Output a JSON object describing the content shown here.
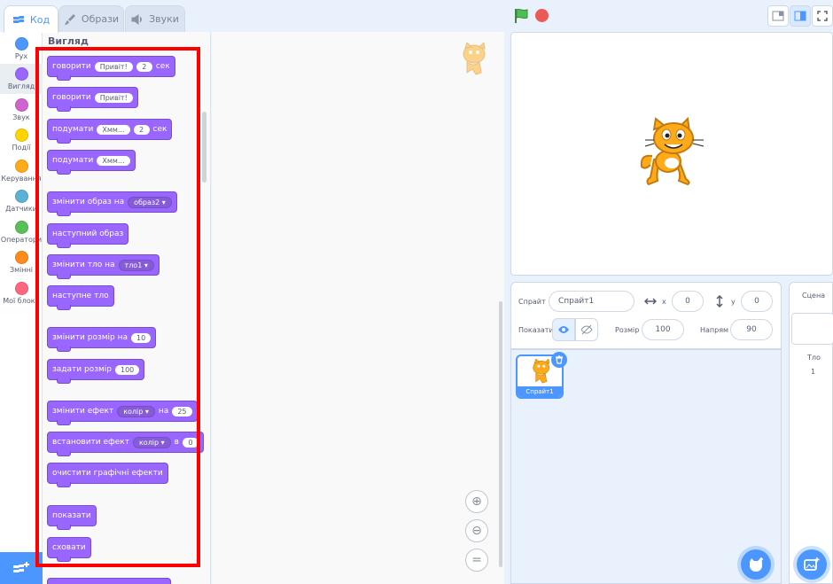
{
  "tabs": {
    "code": "Код",
    "costumes": "Образи",
    "sounds": "Звуки"
  },
  "categories": [
    {
      "label": "Рух",
      "color": "#4c97ff"
    },
    {
      "label": "Вигляд",
      "color": "#9966ff"
    },
    {
      "label": "Звук",
      "color": "#cf63cf"
    },
    {
      "label": "Події",
      "color": "#ffbf00"
    },
    {
      "label": "Керування",
      "color": "#ffab19"
    },
    {
      "label": "Датчики",
      "color": "#5cb1d6"
    },
    {
      "label": "Оператори",
      "color": "#59c059"
    },
    {
      "label": "Змінні",
      "color": "#ff8c1a"
    },
    {
      "label": "Мої блоки",
      "color": "#ff6680"
    }
  ],
  "palette": {
    "title": "Вигляд",
    "blocks": {
      "say_for": {
        "text": "говорити",
        "arg1": "Привіт!",
        "arg2": "2",
        "suffix": "сек"
      },
      "say": {
        "text": "говорити",
        "arg1": "Привіт!"
      },
      "think_for": {
        "text": "подумати",
        "arg1": "Хмм...",
        "arg2": "2",
        "suffix": "сек"
      },
      "think": {
        "text": "подумати",
        "arg1": "Хмм..."
      },
      "switch_costume": {
        "text": "змінити образ на",
        "menu": "образ2"
      },
      "next_costume": {
        "text": "наступний образ"
      },
      "switch_backdrop": {
        "text": "змінити тло на",
        "menu": "тло1"
      },
      "next_backdrop": {
        "text": "наступне тло"
      },
      "change_size": {
        "text": "змінити розмір на",
        "arg1": "10"
      },
      "set_size": {
        "text": "задати розмір",
        "arg1": "100"
      },
      "change_effect": {
        "text": "змінити ефект",
        "menu": "колір",
        "mid": "на",
        "arg1": "25"
      },
      "set_effect": {
        "text": "встановити ефект",
        "menu": "колір",
        "mid": "в",
        "arg1": "0"
      },
      "clear_effects": {
        "text": "очистити графічні ефекти"
      },
      "show": {
        "text": "показати"
      },
      "hide": {
        "text": "сховати"
      }
    }
  },
  "sprite_info": {
    "sprite_label": "Спрайт",
    "sprite_name": "Спрайт1",
    "x_label": "x",
    "x_value": "0",
    "y_label": "y",
    "y_value": "0",
    "show_label": "Показати",
    "size_label": "Розмір",
    "size_value": "100",
    "direction_label": "Напрям",
    "direction_value": "90"
  },
  "sprite_list": {
    "items": [
      {
        "name": "Спрайт1"
      }
    ]
  },
  "stage_pane": {
    "title": "Сцена",
    "backdrops_label": "Тло",
    "backdrops_count": "1"
  },
  "colors": {
    "accent": "#4c97ff",
    "looks": "#9966ff",
    "highlight_box": "#ff0000"
  }
}
